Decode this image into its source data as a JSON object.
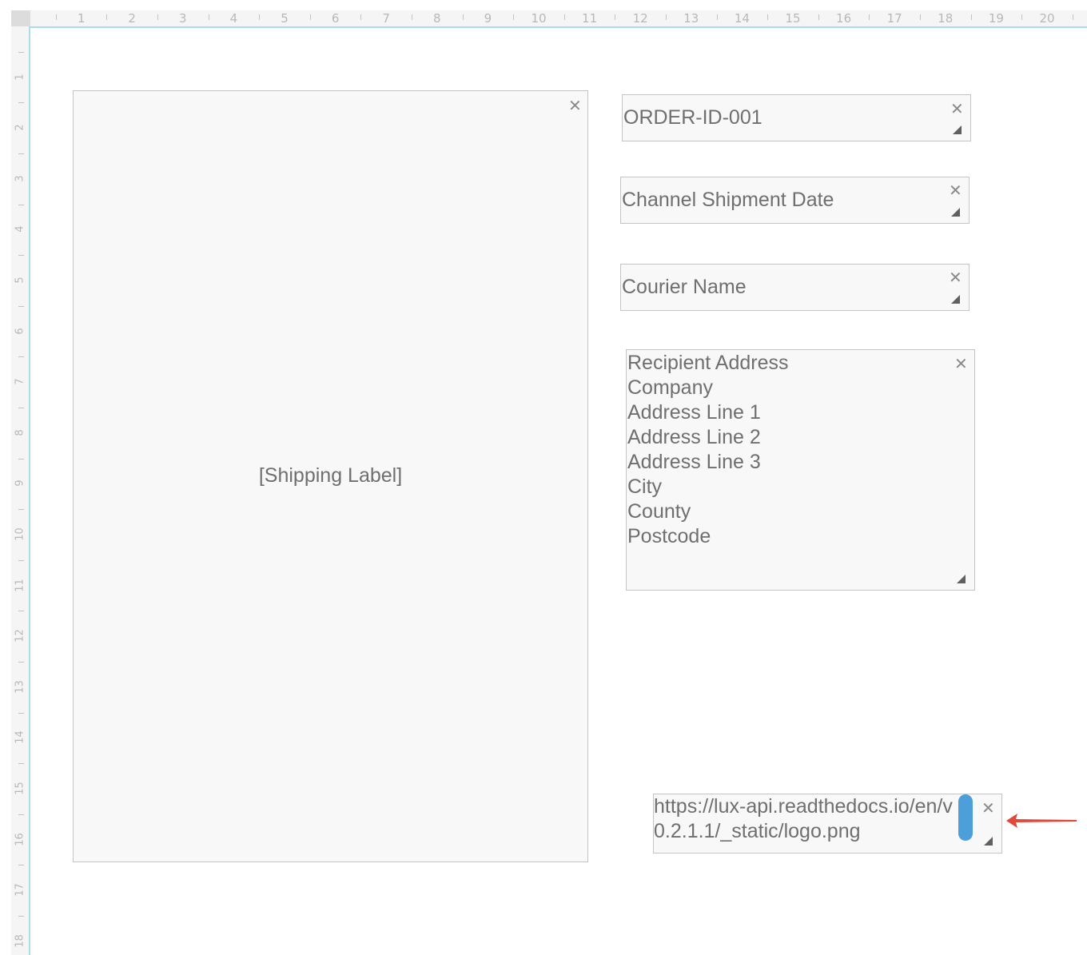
{
  "ruler": {
    "top_numbers": [
      "1",
      "2",
      "3",
      "4",
      "5",
      "6",
      "7",
      "8",
      "9",
      "10",
      "11",
      "12",
      "13",
      "14",
      "15",
      "16",
      "17",
      "18",
      "19",
      "20"
    ],
    "left_numbers": [
      "1",
      "2",
      "3",
      "4",
      "5",
      "6",
      "7",
      "8",
      "9",
      "10",
      "11",
      "12",
      "13",
      "14",
      "15",
      "16",
      "17",
      "18"
    ]
  },
  "shipping_label": {
    "placeholder": "[Shipping Label]"
  },
  "fields": {
    "order_id": "ORDER-ID-001",
    "shipment_date": "Channel Shipment Date",
    "courier_name": "Courier Name"
  },
  "address": {
    "lines": [
      "Recipient Address",
      "Company",
      "Address Line 1",
      "Address Line 2",
      "Address Line 3",
      "City",
      "County",
      "Postcode"
    ]
  },
  "logo_url": {
    "text": "https://lux-api.readthedocs.io/en/v0.2.1.1/_static/logo.png"
  },
  "icons": {
    "close": "close-icon",
    "resize": "resize-handle-icon",
    "arrow": "arrow-left-icon"
  },
  "colors": {
    "accent": "#4d9fda",
    "arrow": "#e0483a",
    "ruler_line": "#a9dde9"
  }
}
